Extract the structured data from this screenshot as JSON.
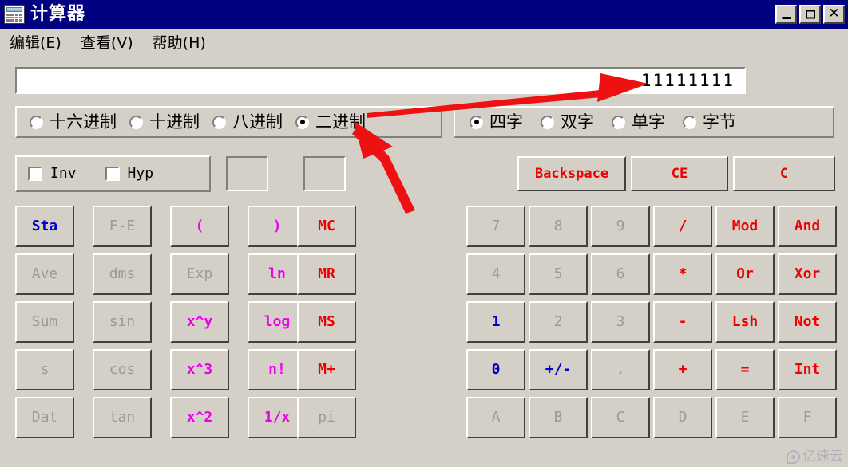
{
  "window": {
    "title": "计算器",
    "icon": "calculator-icon",
    "controls": {
      "minimize": "_",
      "maximize": "□",
      "close": "✕"
    }
  },
  "menu": {
    "items": [
      {
        "label": "编辑(E)"
      },
      {
        "label": "查看(V)"
      },
      {
        "label": "帮助(H)"
      }
    ]
  },
  "display": {
    "value": "11111111"
  },
  "base_group": {
    "options": [
      {
        "label": "十六进制",
        "selected": false
      },
      {
        "label": "十进制",
        "selected": false
      },
      {
        "label": "八进制",
        "selected": false
      },
      {
        "label": "二进制",
        "selected": true
      }
    ]
  },
  "word_group": {
    "options": [
      {
        "label": "四字",
        "selected": true
      },
      {
        "label": "双字",
        "selected": false
      },
      {
        "label": "单字",
        "selected": false
      },
      {
        "label": "字节",
        "selected": false
      }
    ]
  },
  "modifiers": {
    "options": [
      {
        "label": "Inv",
        "checked": false
      },
      {
        "label": "Hyp",
        "checked": false
      }
    ]
  },
  "top_buttons": [
    {
      "label": "Backspace",
      "color": "red"
    },
    {
      "label": "CE",
      "color": "red"
    },
    {
      "label": "C",
      "color": "red"
    }
  ],
  "left_keypad": {
    "rows": [
      [
        {
          "label": "Sta",
          "color": "blue"
        },
        {
          "label": "F-E",
          "color": "gray"
        },
        {
          "label": "(",
          "color": "mag"
        },
        {
          "label": ")",
          "color": "mag"
        },
        {
          "label": "MC",
          "color": "red"
        }
      ],
      [
        {
          "label": "Ave",
          "color": "gray"
        },
        {
          "label": "dms",
          "color": "gray"
        },
        {
          "label": "Exp",
          "color": "gray"
        },
        {
          "label": "ln",
          "color": "mag"
        },
        {
          "label": "MR",
          "color": "red"
        }
      ],
      [
        {
          "label": "Sum",
          "color": "gray"
        },
        {
          "label": "sin",
          "color": "gray"
        },
        {
          "label": "x^y",
          "color": "mag"
        },
        {
          "label": "log",
          "color": "mag"
        },
        {
          "label": "MS",
          "color": "red"
        }
      ],
      [
        {
          "label": "s",
          "color": "gray"
        },
        {
          "label": "cos",
          "color": "gray"
        },
        {
          "label": "x^3",
          "color": "mag"
        },
        {
          "label": "n!",
          "color": "mag"
        },
        {
          "label": "M+",
          "color": "red"
        }
      ],
      [
        {
          "label": "Dat",
          "color": "gray"
        },
        {
          "label": "tan",
          "color": "gray"
        },
        {
          "label": "x^2",
          "color": "mag"
        },
        {
          "label": "1/x",
          "color": "mag"
        },
        {
          "label": "pi",
          "color": "gray"
        }
      ]
    ]
  },
  "right_keypad": {
    "rows": [
      [
        {
          "label": "7",
          "color": "gray"
        },
        {
          "label": "8",
          "color": "gray"
        },
        {
          "label": "9",
          "color": "gray"
        },
        {
          "label": "/",
          "color": "red"
        },
        {
          "label": "Mod",
          "color": "red"
        },
        {
          "label": "And",
          "color": "red"
        }
      ],
      [
        {
          "label": "4",
          "color": "gray"
        },
        {
          "label": "5",
          "color": "gray"
        },
        {
          "label": "6",
          "color": "gray"
        },
        {
          "label": "*",
          "color": "red"
        },
        {
          "label": "Or",
          "color": "red"
        },
        {
          "label": "Xor",
          "color": "red"
        }
      ],
      [
        {
          "label": "1",
          "color": "blue"
        },
        {
          "label": "2",
          "color": "gray"
        },
        {
          "label": "3",
          "color": "gray"
        },
        {
          "label": "-",
          "color": "red"
        },
        {
          "label": "Lsh",
          "color": "red"
        },
        {
          "label": "Not",
          "color": "red"
        }
      ],
      [
        {
          "label": "0",
          "color": "blue"
        },
        {
          "label": "+/-",
          "color": "blue"
        },
        {
          "label": ".",
          "color": "gray"
        },
        {
          "label": "+",
          "color": "red"
        },
        {
          "label": "=",
          "color": "red"
        },
        {
          "label": "Int",
          "color": "red"
        }
      ],
      [
        {
          "label": "A",
          "color": "gray"
        },
        {
          "label": "B",
          "color": "gray"
        },
        {
          "label": "C",
          "color": "gray"
        },
        {
          "label": "D",
          "color": "gray"
        },
        {
          "label": "E",
          "color": "gray"
        },
        {
          "label": "F",
          "color": "gray"
        }
      ]
    ]
  },
  "annotations": {
    "arrow_color": "#ee1111",
    "arrows": [
      {
        "name": "arrow-to-display",
        "points_to": "display-value"
      },
      {
        "name": "arrow-to-binary-radio",
        "points_to": "radio-binary"
      }
    ]
  },
  "watermark": {
    "text": "亿速云"
  },
  "colors": {
    "titlebar": "#000080",
    "face": "#d4d0c8",
    "red": "#ee0000",
    "blue": "#0000cc",
    "magenta": "#ee00ee",
    "disabled": "#9a9a9a"
  }
}
